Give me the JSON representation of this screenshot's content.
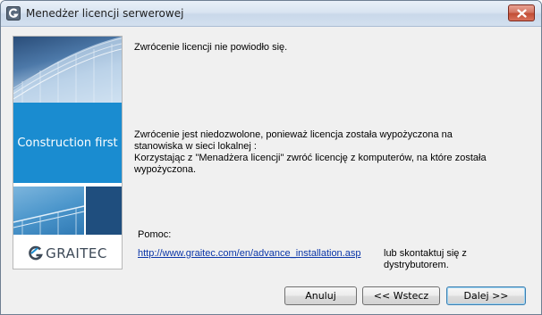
{
  "window": {
    "title": "Menedżer licencji serwerowej",
    "icon": "graitec-g-icon"
  },
  "banner": {
    "slogan": "Construction first",
    "brand": "GRAITEC",
    "brand_color": "#1a8cd0"
  },
  "message": {
    "title": "Zwrócenie licencji nie powiodło się.",
    "body_lines": [
      "Zwrócenie jest niedozwolone, ponieważ licencja została wypożyczona na",
      "stanowiska w sieci lokalnej :",
      "Korzystając z \"Menadżera licencji\" zwróć licencję z komputerów, na które została",
      "wypożyczona."
    ]
  },
  "help": {
    "label": "Pomoc:",
    "link": "http://www.graitec.com/en/advance_installation.asp",
    "contact": "lub skontaktuj się z dystrybutorem."
  },
  "buttons": {
    "cancel": "Anuluj",
    "back": "<< Wstecz",
    "next": "Dalej >>"
  }
}
